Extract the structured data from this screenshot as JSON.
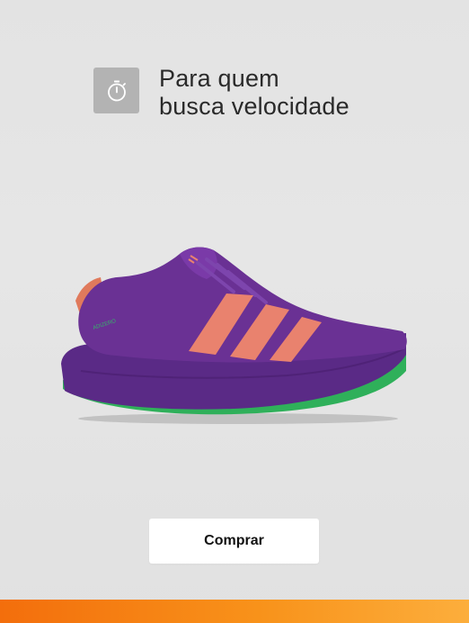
{
  "headline": {
    "icon": "stopwatch-icon",
    "line1": "Para quem",
    "line2": "busca velocidade"
  },
  "product": {
    "image": "running-shoe-image",
    "colors": {
      "upper": "#6a3194",
      "sole": "#5a2a86",
      "stripes": "#e9826e",
      "outsole_accent": "#2fb05a"
    }
  },
  "cta": {
    "label": "Comprar"
  },
  "colors": {
    "background": "#e4e4e4",
    "icon_tile": "#b3b3b3",
    "accent_bar_start": "#f36e0c",
    "accent_bar_end": "#fcae3c"
  }
}
